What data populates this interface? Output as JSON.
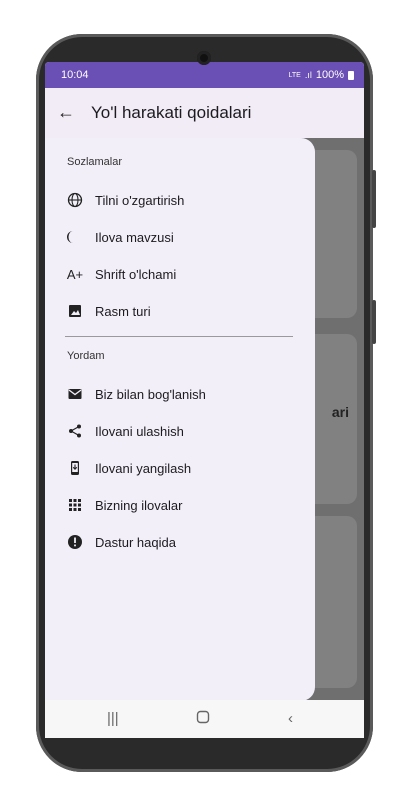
{
  "status": {
    "time": "10:04",
    "signal": "LTE",
    "battery": "100%"
  },
  "appbar": {
    "title": "Yo'l harakati qoidalari"
  },
  "background": {
    "partial_text": "ari"
  },
  "drawer": {
    "section1": "Sozlamalar",
    "section2": "Yordam",
    "items1": [
      {
        "label": "Tilni o'zgartirish",
        "icon": "globe"
      },
      {
        "label": "Ilova mavzusi",
        "icon": "moon"
      },
      {
        "label": "Shrift o'lchami",
        "icon": "A+"
      },
      {
        "label": "Rasm turi",
        "icon": "image"
      }
    ],
    "items2": [
      {
        "label": "Biz bilan bog'lanish",
        "icon": "mail"
      },
      {
        "label": "Ilovani ulashish",
        "icon": "share"
      },
      {
        "label": "Ilovani yangilash",
        "icon": "update-phone"
      },
      {
        "label": "Bizning ilovalar",
        "icon": "apps-grid"
      },
      {
        "label": "Dastur haqida",
        "icon": "info"
      }
    ]
  },
  "icons": {
    "a_plus": "A+"
  }
}
